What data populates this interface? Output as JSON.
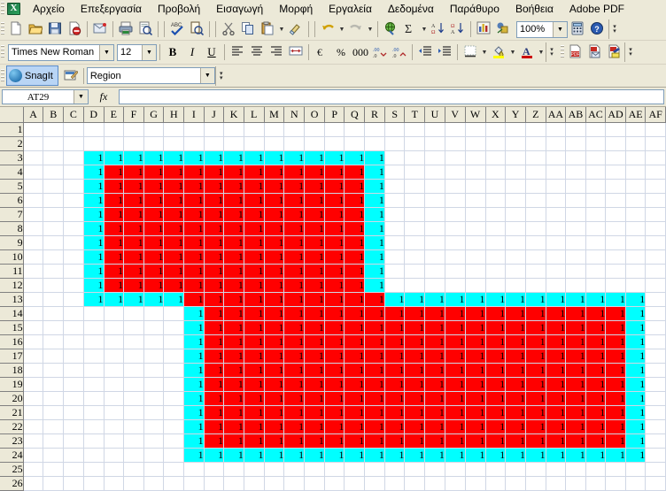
{
  "window": {
    "app_icon": "excel-icon"
  },
  "menubar": {
    "items": [
      {
        "label": "Αρχείο",
        "name": "menu-file"
      },
      {
        "label": "Επεξεργασία",
        "name": "menu-edit"
      },
      {
        "label": "Προβολή",
        "name": "menu-view"
      },
      {
        "label": "Εισαγωγή",
        "name": "menu-insert"
      },
      {
        "label": "Μορφή",
        "name": "menu-format"
      },
      {
        "label": "Εργαλεία",
        "name": "menu-tools"
      },
      {
        "label": "Δεδομένα",
        "name": "menu-data"
      },
      {
        "label": "Παράθυρο",
        "name": "menu-window"
      },
      {
        "label": "Βοήθεια",
        "name": "menu-help"
      },
      {
        "label": "Adobe PDF",
        "name": "menu-adobe-pdf"
      }
    ]
  },
  "standard_toolbar": {
    "buttons": [
      {
        "icon": "new-document-icon",
        "name": "new-button"
      },
      {
        "icon": "open-folder-icon",
        "name": "open-button"
      },
      {
        "icon": "save-disk-icon",
        "name": "save-button"
      },
      {
        "icon": "permission-icon",
        "name": "permission-button"
      },
      {
        "icon": "email-icon",
        "name": "email-button"
      },
      {
        "icon": "print-icon",
        "name": "print-button"
      },
      {
        "icon": "print-preview-icon",
        "name": "print-preview-button"
      },
      {
        "icon": "spelling-abc-check-icon",
        "name": "spelling-button"
      },
      {
        "icon": "research-icon",
        "name": "research-button"
      },
      {
        "icon": "scissors-cut-icon",
        "name": "cut-button"
      },
      {
        "icon": "copy-icon",
        "name": "copy-button"
      },
      {
        "icon": "paste-clipboard-icon",
        "name": "paste-button"
      },
      {
        "icon": "format-painter-brush-icon",
        "name": "format-painter-button"
      },
      {
        "icon": "undo-arrow-icon",
        "name": "undo-button"
      },
      {
        "icon": "redo-arrow-icon",
        "name": "redo-button"
      },
      {
        "icon": "hyperlink-globe-icon",
        "name": "hyperlink-button"
      },
      {
        "icon": "autosum-sigma-icon",
        "name": "autosum-button"
      },
      {
        "icon": "sort-ascending-icon",
        "name": "sort-ascending-button"
      },
      {
        "icon": "sort-descending-icon",
        "name": "sort-descending-button"
      },
      {
        "icon": "chart-wizard-icon",
        "name": "chart-wizard-button"
      },
      {
        "icon": "drawing-icon",
        "name": "drawing-button"
      },
      {
        "icon": "calculator-icon",
        "name": "calculator-button"
      },
      {
        "icon": "help-question-icon",
        "name": "help-button"
      }
    ],
    "zoom_value": "100%"
  },
  "formatting_toolbar": {
    "font_name": "Times New Roman",
    "font_size": "12",
    "bold_label": "B",
    "italic_label": "I",
    "underline_label": "U",
    "percent_label": "%",
    "comma_label": "000",
    "buttons": [
      {
        "icon": "align-left-icon",
        "name": "align-left-button"
      },
      {
        "icon": "align-center-icon",
        "name": "align-center-button"
      },
      {
        "icon": "align-right-icon",
        "name": "align-right-button"
      },
      {
        "icon": "merge-cells-icon",
        "name": "merge-center-button"
      },
      {
        "icon": "currency-icon",
        "name": "currency-button"
      },
      {
        "icon": "increase-decimal-icon",
        "name": "increase-decimal-button"
      },
      {
        "icon": "decrease-decimal-icon",
        "name": "decrease-decimal-button"
      },
      {
        "icon": "decrease-indent-icon",
        "name": "decrease-indent-button"
      },
      {
        "icon": "increase-indent-icon",
        "name": "increase-indent-button"
      },
      {
        "icon": "borders-icon",
        "name": "borders-button"
      },
      {
        "icon": "fill-color-icon",
        "name": "fill-color-button"
      },
      {
        "icon": "font-color-icon",
        "name": "font-color-button"
      }
    ]
  },
  "adobe_toolbar": {
    "buttons": [
      {
        "icon": "convert-to-pdf-icon",
        "name": "convert-to-pdf-button"
      },
      {
        "icon": "convert-and-email-pdf-icon",
        "name": "convert-email-pdf-button"
      },
      {
        "icon": "convert-and-review-pdf-icon",
        "name": "convert-review-pdf-button"
      }
    ]
  },
  "snagit_toolbar": {
    "capture_label": "SnagIt",
    "profile_value": "Region",
    "properties_icon": "snagit-properties-icon"
  },
  "formula_bar": {
    "name_box_value": "AT29",
    "fx_label": "fx",
    "formula_value": ""
  },
  "grid": {
    "columns": [
      "A",
      "B",
      "C",
      "D",
      "E",
      "F",
      "G",
      "H",
      "I",
      "J",
      "K",
      "L",
      "M",
      "N",
      "O",
      "P",
      "Q",
      "R",
      "S",
      "T",
      "U",
      "V",
      "W",
      "X",
      "Y",
      "Z",
      "AA",
      "AB",
      "AC",
      "AD",
      "AE",
      "AF"
    ],
    "rows": [
      1,
      2,
      3,
      4,
      5,
      6,
      7,
      8,
      9,
      10,
      11,
      12,
      13,
      14,
      15,
      16,
      17,
      18,
      19,
      20,
      21,
      22,
      23,
      24,
      25,
      26
    ],
    "cell_value": "1",
    "colors": {
      "border_fill": "#00FFFF",
      "interior_fill": "#FF0000",
      "gridline": "#D0D7E5",
      "header_bg": "#ECE9D8"
    },
    "shape": {
      "description": "Z-shaped merged region drawn with cyan outline cells and red interior cells, all containing the value 1",
      "upper_block": {
        "col_start": "D",
        "col_end": "R",
        "row_start": 3,
        "row_end": 13
      },
      "lower_block": {
        "col_start": "I",
        "col_end": "AE",
        "row_start": 13,
        "row_end": 24
      }
    }
  }
}
